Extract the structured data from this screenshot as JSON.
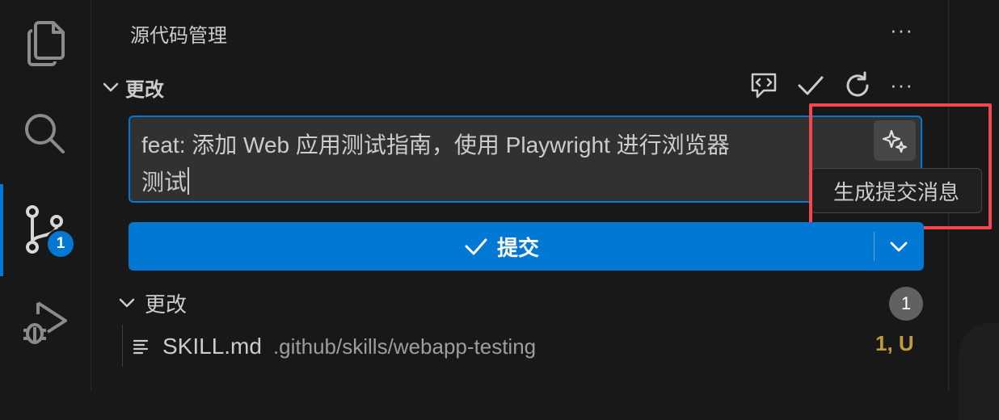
{
  "activity_bar": {
    "items": [
      {
        "icon": "files-icon"
      },
      {
        "icon": "search-icon"
      },
      {
        "icon": "source-control-icon",
        "badge": "1",
        "active": true
      },
      {
        "icon": "run-debug-icon"
      }
    ]
  },
  "panel": {
    "title": "源代码管理",
    "more_label": "···"
  },
  "changes_section": {
    "header": "更改",
    "toolbar": [
      "chat-icon",
      "check-icon",
      "refresh-icon",
      "more-icon"
    ],
    "more_label": "···"
  },
  "commit_message": {
    "value": "feat: 添加 Web 应用测试指南，使用 Playwright 进行浏览器\n测试"
  },
  "generate_button": {
    "icon": "sparkle-icon",
    "tooltip": "生成提交消息"
  },
  "commit_button": {
    "label": "提交",
    "icon": "check-icon"
  },
  "changes_group": {
    "label": "更改",
    "count": "1"
  },
  "files": [
    {
      "name": "SKILL.md",
      "path": ".github/skills/webapp-testing",
      "status": "1, U"
    }
  ],
  "colors": {
    "accent": "#0078d4",
    "highlight": "#f0484e",
    "status_untracked": "#c09a3b"
  }
}
